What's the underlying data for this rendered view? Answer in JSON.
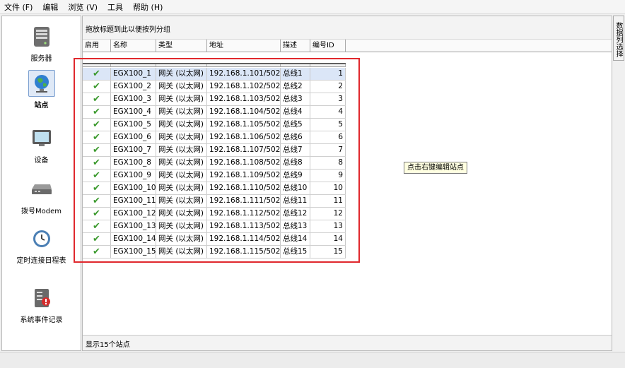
{
  "menu": [
    "文件 (F)",
    "编辑",
    "浏览 (V)",
    "工具",
    "帮助 (H)"
  ],
  "sidebar": {
    "items": [
      {
        "label": "服务器",
        "icon": "server-icon",
        "active": false
      },
      {
        "label": "站点",
        "icon": "globe-icon",
        "active": true
      },
      {
        "label": "设备",
        "icon": "monitor-icon",
        "active": false
      },
      {
        "label": "拨号Modem",
        "icon": "modem-icon",
        "active": false
      },
      {
        "label": "定时连接日程表",
        "icon": "clock-icon",
        "active": false
      },
      {
        "label": "系统事件记录",
        "icon": "event-log-icon",
        "active": false
      }
    ]
  },
  "grid": {
    "group_hint": "拖放标题到此以便按列分组",
    "columns": [
      "启用",
      "名称",
      "类型",
      "地址",
      "描述",
      "编号ID"
    ],
    "rows": [
      {
        "enabled": true,
        "name": "EGX100_1",
        "type": "网关 (以太网)",
        "address": "192.168.1.101/502",
        "desc": "总线1",
        "id": "1"
      },
      {
        "enabled": true,
        "name": "EGX100_2",
        "type": "网关 (以太网)",
        "address": "192.168.1.102/502",
        "desc": "总线2",
        "id": "2"
      },
      {
        "enabled": true,
        "name": "EGX100_3",
        "type": "网关 (以太网)",
        "address": "192.168.1.103/502",
        "desc": "总线3",
        "id": "3"
      },
      {
        "enabled": true,
        "name": "EGX100_4",
        "type": "网关 (以太网)",
        "address": "192.168.1.104/502",
        "desc": "总线4",
        "id": "4"
      },
      {
        "enabled": true,
        "name": "EGX100_5",
        "type": "网关 (以太网)",
        "address": "192.168.1.105/502",
        "desc": "总线5",
        "id": "5"
      },
      {
        "enabled": true,
        "name": "EGX100_6",
        "type": "网关 (以太网)",
        "address": "192.168.1.106/502",
        "desc": "总线6",
        "id": "6"
      },
      {
        "enabled": true,
        "name": "EGX100_7",
        "type": "网关 (以太网)",
        "address": "192.168.1.107/502",
        "desc": "总线7",
        "id": "7"
      },
      {
        "enabled": true,
        "name": "EGX100_8",
        "type": "网关 (以太网)",
        "address": "192.168.1.108/502",
        "desc": "总线8",
        "id": "8"
      },
      {
        "enabled": true,
        "name": "EGX100_9",
        "type": "网关 (以太网)",
        "address": "192.168.1.109/502",
        "desc": "总线9",
        "id": "9"
      },
      {
        "enabled": true,
        "name": "EGX100_10",
        "type": "网关 (以太网)",
        "address": "192.168.1.110/502",
        "desc": "总线10",
        "id": "10"
      },
      {
        "enabled": true,
        "name": "EGX100_11",
        "type": "网关 (以太网)",
        "address": "192.168.1.111/502",
        "desc": "总线11",
        "id": "11"
      },
      {
        "enabled": true,
        "name": "EGX100_12",
        "type": "网关 (以太网)",
        "address": "192.168.1.112/502",
        "desc": "总线12",
        "id": "12"
      },
      {
        "enabled": true,
        "name": "EGX100_13",
        "type": "网关 (以太网)",
        "address": "192.168.1.113/502",
        "desc": "总线13",
        "id": "13"
      },
      {
        "enabled": true,
        "name": "EGX100_14",
        "type": "网关 (以太网)",
        "address": "192.168.1.114/502",
        "desc": "总线14",
        "id": "14"
      },
      {
        "enabled": true,
        "name": "EGX100_15",
        "type": "网关 (以太网)",
        "address": "192.168.1.115/502",
        "desc": "总线15",
        "id": "15"
      }
    ],
    "selected_row": 0
  },
  "tooltip": "点击右键编辑站点",
  "status": "显示15个站点",
  "right_tab": "数据列选择",
  "colors": {
    "highlight": "#e0282d",
    "check": "#3c9a2e",
    "selection": "#dbe6f7"
  }
}
